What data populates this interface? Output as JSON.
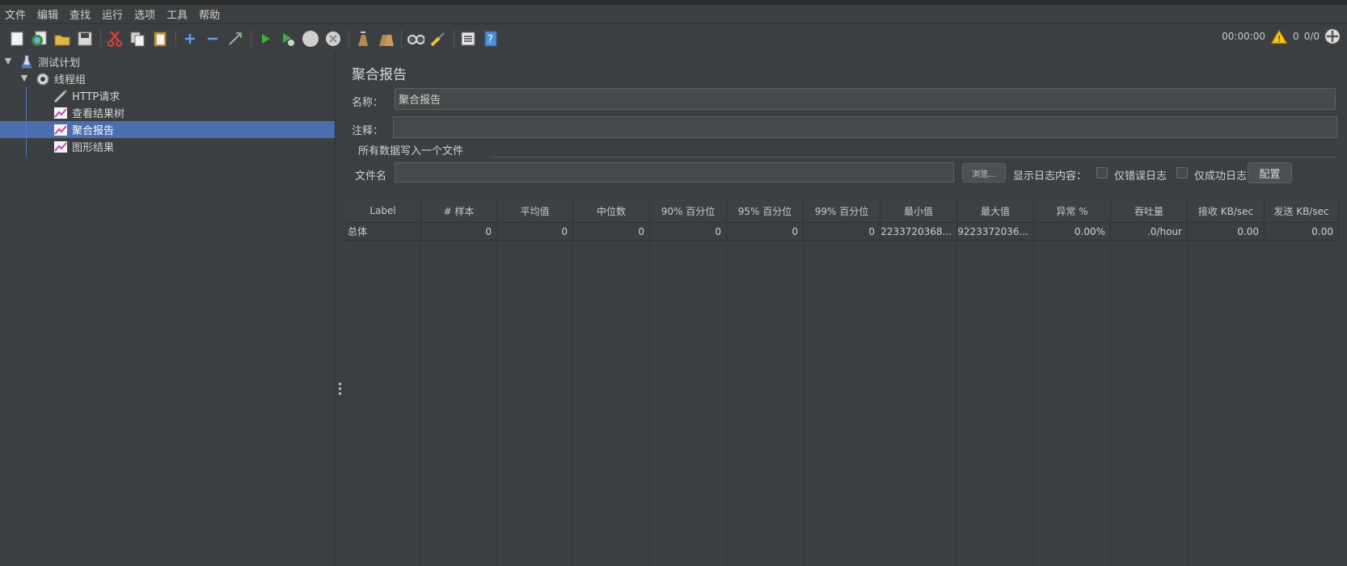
{
  "menu": [
    "文件",
    "编辑",
    "查找",
    "运行",
    "选项",
    "工具",
    "帮助"
  ],
  "toolbar_icons": [
    "new-icon",
    "templates-icon",
    "open-icon",
    "save-icon",
    "cut-icon",
    "copy-icon",
    "paste-icon",
    "expand-icon",
    "collapse-icon",
    "toggle-icon",
    "start-icon",
    "start-no-pause-icon",
    "stop-icon",
    "shutdown-icon",
    "clear-icon",
    "clear-all-icon",
    "search-icon",
    "reset-search-icon",
    "function-helper-icon",
    "help-icon"
  ],
  "status": {
    "timer": "00:00:00",
    "warnings": "0",
    "threads": "0/0"
  },
  "tree": {
    "root": "测试计划",
    "thread_group": "线程组",
    "children": [
      "HTTP请求",
      "查看结果树",
      "聚合报告",
      "图形结果"
    ]
  },
  "panel": {
    "title": "聚合报告",
    "name_label": "名称：",
    "name_value": "聚合报告",
    "comment_label": "注释：",
    "comment_value": "",
    "group_title": "所有数据写入一个文件",
    "filename_label": "文件名",
    "filename_value": "",
    "browse_label": "浏览...",
    "show_log_label": "显示日志内容：",
    "errors_only_label": "仅错误日志",
    "success_only_label": "仅成功日志",
    "config_label": "配置"
  },
  "table": {
    "headers": [
      "Label",
      "# 样本",
      "平均值",
      "中位数",
      "90% 百分位",
      "95% 百分位",
      "99% 百分位",
      "最小值",
      "最大值",
      "异常 %",
      "吞吐量",
      "接收 KB/sec",
      "发送 KB/sec"
    ],
    "row": [
      "总体",
      "0",
      "0",
      "0",
      "0",
      "0",
      "0",
      "92233720368...",
      "-9223372036...",
      "0.00%",
      ".0/hour",
      "0.00",
      "0.00"
    ]
  },
  "colors": {
    "background": "#3c3f41",
    "selection": "#4b6eaf",
    "field": "#45494a"
  }
}
